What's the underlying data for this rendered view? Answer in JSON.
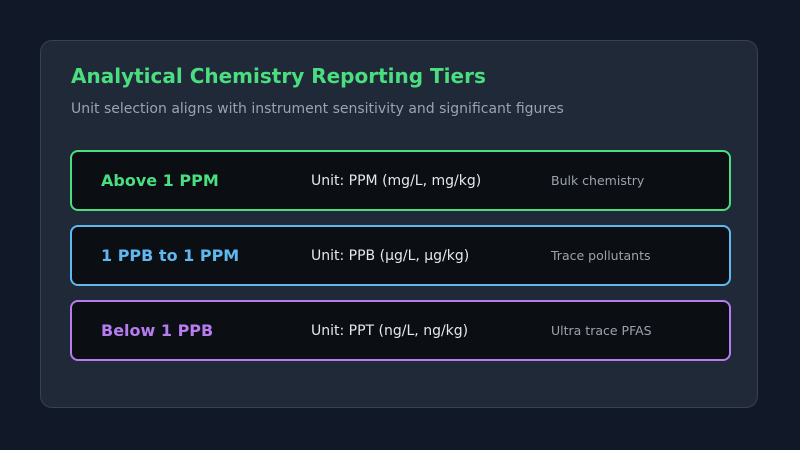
{
  "header": {
    "title": "Analytical Chemistry Reporting Tiers",
    "subtitle": "Unit selection aligns with instrument sensitivity and significant figures"
  },
  "tiers": [
    {
      "range": "Above 1 PPM",
      "unit": "Unit: PPM (mg/L, mg/kg)",
      "use": "Bulk chemistry",
      "color": "#4ade80"
    },
    {
      "range": "1 PPB to 1 PPM",
      "unit": "Unit: PPB (µg/L, µg/kg)",
      "use": "Trace pollutants",
      "color": "#60b8f0"
    },
    {
      "range": "Below 1 PPB",
      "unit": "Unit: PPT (ng/L, ng/kg)",
      "use": "Ultra trace PFAS",
      "color": "#b77cf0"
    }
  ],
  "colors": {
    "background": "#111827",
    "card": "#1f2937",
    "title": "#4ade80"
  }
}
